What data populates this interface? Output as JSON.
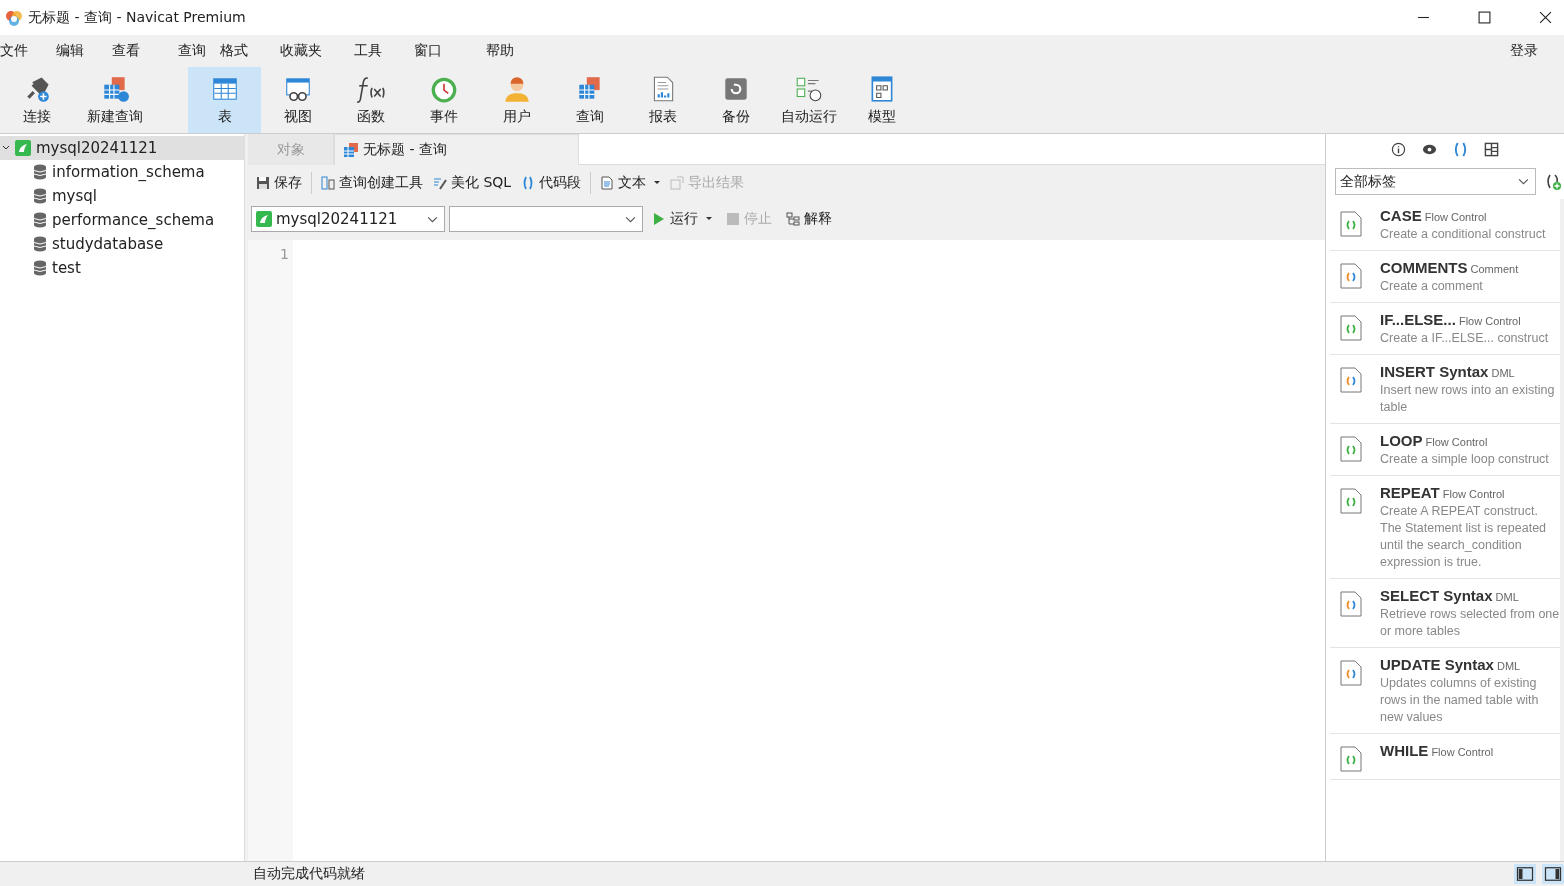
{
  "window": {
    "title": "无标题 - 查询 - Navicat Premium"
  },
  "menu": [
    "文件",
    "编辑",
    "查看",
    "查询",
    "格式",
    "收藏夹",
    "工具",
    "窗口",
    "帮助"
  ],
  "login": "登录",
  "toolbar": [
    {
      "kind": "connect",
      "label": "连接",
      "selected": false
    },
    {
      "kind": "newquery",
      "label": "新建查询",
      "selected": false
    },
    {
      "kind": "table",
      "label": "表",
      "selected": true
    },
    {
      "kind": "view",
      "label": "视图",
      "selected": false
    },
    {
      "kind": "function",
      "label": "函数",
      "selected": false
    },
    {
      "kind": "event",
      "label": "事件",
      "selected": false
    },
    {
      "kind": "user",
      "label": "用户",
      "selected": false
    },
    {
      "kind": "query",
      "label": "查询",
      "selected": false
    },
    {
      "kind": "report",
      "label": "报表",
      "selected": false
    },
    {
      "kind": "backup",
      "label": "备份",
      "selected": false
    },
    {
      "kind": "schedule",
      "label": "自动运行",
      "selected": false
    },
    {
      "kind": "model",
      "label": "模型",
      "selected": false
    }
  ],
  "sidebar": {
    "items": [
      {
        "label": "mysql20241121",
        "expanded": true,
        "selected": true,
        "children": [
          {
            "label": "information_schema"
          },
          {
            "label": "mysql"
          },
          {
            "label": "performance_schema"
          },
          {
            "label": "studydatabase"
          },
          {
            "label": "test"
          }
        ]
      }
    ]
  },
  "tabs": [
    {
      "label": "对象",
      "selected": false
    },
    {
      "label": "无标题 - 查询",
      "selected": true
    }
  ],
  "query_toolbar": [
    {
      "kind": "save",
      "label": "保存",
      "disabled": false
    },
    {
      "kind": "builder",
      "label": "查询创建工具",
      "disabled": false
    },
    {
      "kind": "beautify",
      "label": "美化 SQL",
      "disabled": false
    },
    {
      "kind": "snippet",
      "label": "代码段",
      "disabled": false
    },
    {
      "kind": "text",
      "label": "文本",
      "disabled": false
    },
    {
      "kind": "export",
      "label": "导出结果",
      "disabled": true
    }
  ],
  "connection_select": {
    "value": "mysql20241121"
  },
  "run_bar": [
    {
      "kind": "run",
      "label": "运行",
      "disabled": false
    },
    {
      "kind": "stop",
      "label": "停止",
      "disabled": true
    },
    {
      "kind": "explain",
      "label": "解释",
      "disabled": false
    }
  ],
  "editor": {
    "line_numbers": [
      "1"
    ]
  },
  "snippets_panel": {
    "tag_select": "全部标签",
    "items": [
      {
        "kind": "flow",
        "title": "CASE",
        "category": "Flow Control",
        "description": "Create a conditional construct"
      },
      {
        "kind": "multi",
        "title": "COMMENTS",
        "category": "Comment",
        "description": "Create a comment"
      },
      {
        "kind": "flow",
        "title": "IF...ELSE...",
        "category": "Flow Control",
        "description": "Create a IF...ELSE... construct"
      },
      {
        "kind": "multi",
        "title": "INSERT Syntax",
        "category": "DML",
        "description": "Insert new rows into an existing table"
      },
      {
        "kind": "flow",
        "title": "LOOP",
        "category": "Flow Control",
        "description": "Create a simple loop construct"
      },
      {
        "kind": "flow",
        "title": "REPEAT",
        "category": "Flow Control",
        "description": "Create A REPEAT construct. The Statement list is repeated until the search_condition expression is true."
      },
      {
        "kind": "multi",
        "title": "SELECT Syntax",
        "category": "DML",
        "description": "Retrieve rows selected from one or more tables"
      },
      {
        "kind": "multi",
        "title": "UPDATE Syntax",
        "category": "DML",
        "description": "Updates columns of existing rows in the named table with new values"
      },
      {
        "kind": "flow",
        "title": "WHILE",
        "category": "Flow Control"
      }
    ]
  },
  "status_bar": {
    "text": "自动完成代码就绪"
  }
}
